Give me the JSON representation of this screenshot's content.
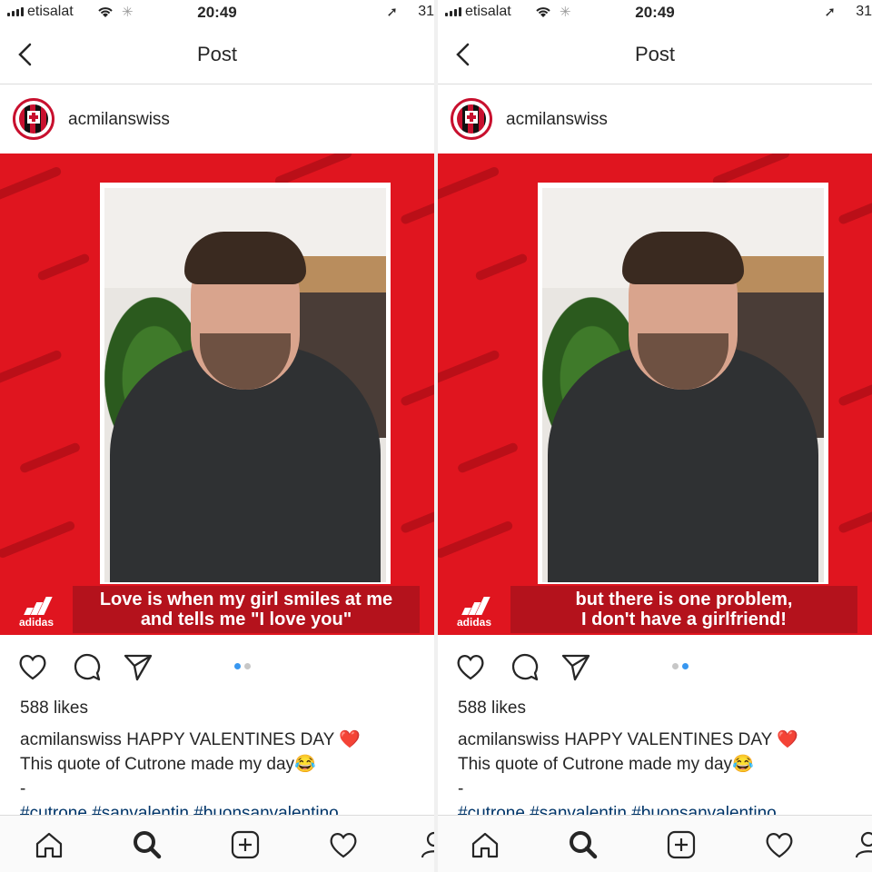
{
  "panels": [
    {
      "status": {
        "carrier": "etisalat",
        "time": "20:49",
        "battery": "31"
      },
      "nav": {
        "title": "Post"
      },
      "post": {
        "username": "acmilanswiss",
        "caption_line1": "Love is when my girl smiles at me",
        "caption_line2": "and tells me \"I love you\"",
        "sponsor": "adidas",
        "likes": "588 likes",
        "author": "acmilanswiss",
        "text1": "HAPPY VALENTINES DAY",
        "emoji1": "❤️",
        "text2": "This quote of Cutrone made my day",
        "emoji2": "😂",
        "text3": "-",
        "hashtags": "#cutrone #sanvalentin #buonsanvalentino",
        "active_slide": 0
      }
    },
    {
      "status": {
        "carrier": "etisalat",
        "time": "20:49",
        "battery": "31"
      },
      "nav": {
        "title": "Post"
      },
      "post": {
        "username": "acmilanswiss",
        "caption_line1": "but there is one problem,",
        "caption_line2": "I don't have a girlfriend!",
        "sponsor": "adidas",
        "likes": "588 likes",
        "author": "acmilanswiss",
        "text1": "HAPPY VALENTINES DAY",
        "emoji1": "❤️",
        "text2": "This quote of Cutrone made my day",
        "emoji2": "😂",
        "text3": "-",
        "hashtags": "#cutrone #sanvalentin #buonsanvalentino",
        "active_slide": 1
      }
    }
  ],
  "colors": {
    "brand_red": "#e0151f",
    "link": "#003569",
    "active_dot": "#3897f0"
  },
  "icons": [
    "back-chevron-icon",
    "heart-icon",
    "comment-icon",
    "share-icon",
    "home-icon",
    "search-icon",
    "add-icon",
    "activity-heart-icon"
  ]
}
